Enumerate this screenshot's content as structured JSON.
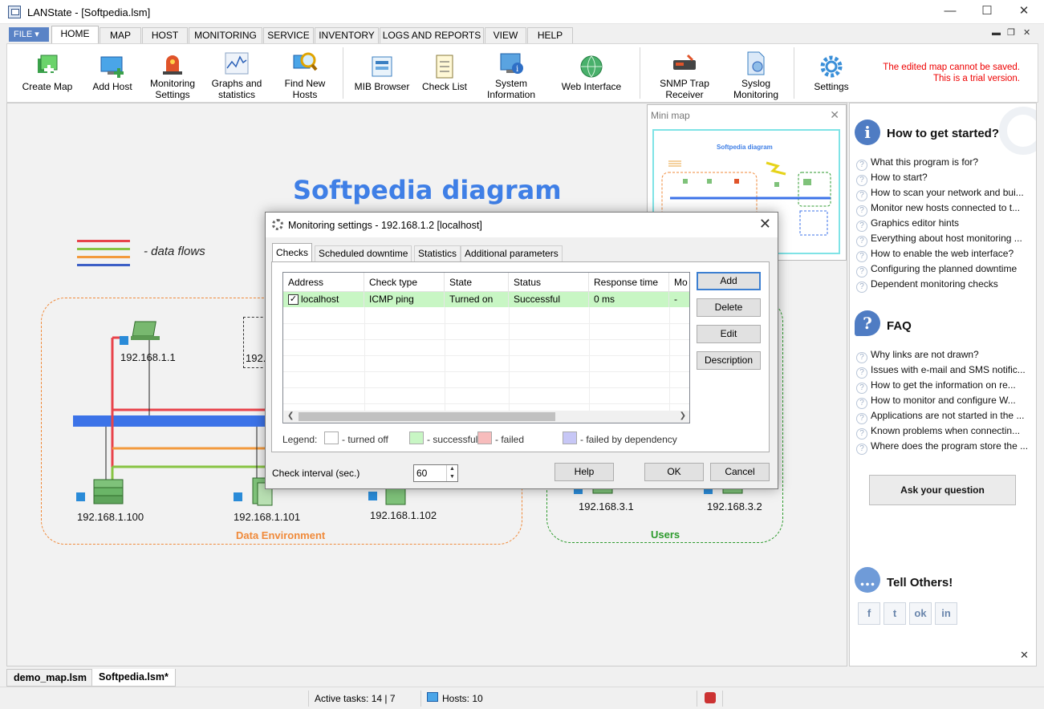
{
  "window": {
    "title": "LANState - [Softpedia.lsm]",
    "min_icon": "minimize-icon",
    "max_icon": "maximize-icon",
    "close_icon": "close-icon"
  },
  "menu": {
    "file": "FILE",
    "tabs": [
      "HOME",
      "MAP",
      "HOST",
      "MONITORING",
      "SERVICE",
      "INVENTORY",
      "LOGS AND REPORTS",
      "VIEW",
      "HELP"
    ],
    "active_tab": "HOME"
  },
  "ribbon": {
    "buttons": [
      {
        "label1": "Create Map",
        "label2": "",
        "icon": "create-map-icon"
      },
      {
        "label1": "Add Host",
        "label2": "",
        "icon": "add-host-icon"
      },
      {
        "label1": "Monitoring",
        "label2": "Settings",
        "icon": "siren-icon"
      },
      {
        "label1": "Graphs and",
        "label2": "statistics",
        "icon": "graph-icon"
      },
      {
        "label1": "Find New",
        "label2": "Hosts",
        "icon": "magnifier-icon"
      },
      {
        "label1": "MIB Browser",
        "label2": "",
        "icon": "mib-browser-icon"
      },
      {
        "label1": "Check List",
        "label2": "",
        "icon": "checklist-icon"
      },
      {
        "label1": "System",
        "label2": "Information",
        "icon": "system-info-icon"
      },
      {
        "label1": "Web Interface",
        "label2": "",
        "icon": "globe-icon"
      },
      {
        "label1": "SNMP Trap",
        "label2": "Receiver",
        "icon": "snmp-trap-icon"
      },
      {
        "label1": "Syslog",
        "label2": "Monitoring",
        "icon": "syslog-icon"
      },
      {
        "label1": "Settings",
        "label2": "",
        "icon": "gear-icon"
      }
    ],
    "trial_line1": "The edited map cannot be saved.",
    "trial_line2": "This is a trial version."
  },
  "diagram": {
    "title": "Softpedia diagram",
    "legend_text": "- data flows",
    "flow_colors": [
      "#e8434b",
      "#88c443",
      "#f39a3d",
      "#3c5fc6"
    ],
    "zones": [
      {
        "label": "Data Environment",
        "color": "#f08a3a"
      },
      {
        "label": "Users",
        "color": "#2c9a2c"
      }
    ],
    "hosts": [
      "192.168.1.1",
      "192.",
      "192.168.1.100",
      "192.168.1.101",
      "192.168.1.102",
      "192.168.3.1",
      "192.168.3.2"
    ]
  },
  "minimap": {
    "title": "Mini map",
    "inner_title": "Softpedia diagram"
  },
  "help_panel": {
    "get_started": {
      "heading": "How to get started?",
      "links": [
        "What this program is for?",
        "How to start?",
        "How to scan your network and bui...",
        "Monitor new hosts connected to t...",
        "Graphics editor hints",
        "Everything about host monitoring ...",
        "How to enable the web interface?",
        "Configuring the planned downtime",
        "Dependent monitoring checks"
      ]
    },
    "faq": {
      "heading": "FAQ",
      "links": [
        "Why links are not drawn?",
        "Issues with e-mail and SMS notific...",
        "How to get the information on re...",
        "How to monitor and configure W...",
        "Applications are not started in the ...",
        "Known problems when connectin...",
        "Where does the program store the ..."
      ]
    },
    "ask_button": "Ask your question",
    "tell_others": "Tell Others!",
    "social": [
      "f",
      "t",
      "ok",
      "in"
    ]
  },
  "doc_tabs": [
    "demo_map.lsm",
    "Softpedia.lsm*"
  ],
  "status": {
    "active_tasks": "Active tasks: 14 | 7",
    "hosts": "Hosts: 10"
  },
  "dialog": {
    "title": "Monitoring settings - 192.168.1.2 [localhost]",
    "tabs": [
      "Checks",
      "Scheduled downtime",
      "Statistics",
      "Additional parameters"
    ],
    "columns": [
      "Address",
      "Check type",
      "State",
      "Status",
      "Response time",
      "Mo"
    ],
    "rows": [
      {
        "address": "localhost",
        "check_type": "ICMP ping",
        "state": "Turned on",
        "status": "Successful",
        "response": "0 ms",
        "mo": "-"
      }
    ],
    "buttons": {
      "add": "Add",
      "delete": "Delete",
      "edit": "Edit",
      "description": "Description"
    },
    "legend": {
      "label": "Legend:",
      "off": "- turned off",
      "ok": "- successful",
      "failed": "- failed",
      "dep": "- failed by dependency"
    },
    "interval_label": "Check interval (sec.)",
    "interval_value": "60",
    "help": "Help",
    "ok": "OK",
    "cancel": "Cancel"
  }
}
